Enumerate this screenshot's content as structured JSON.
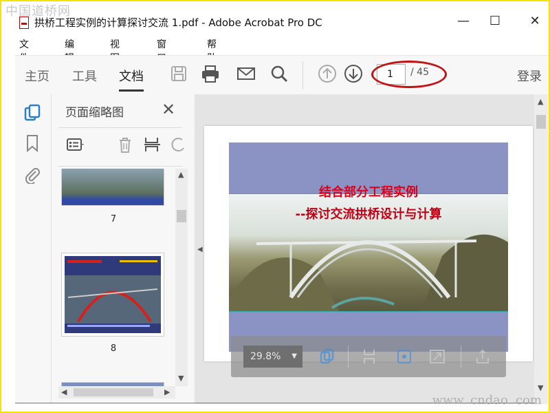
{
  "watermark_top": "中国道桥网",
  "watermark_bottom": "www. cndao. com",
  "window": {
    "title": "拱桥工程实例的计算探讨交流 1.pdf - Adobe Acrobat Pro DC",
    "minimize": "—",
    "maximize": "☐",
    "close": "✕"
  },
  "menu": [
    "文件(F)",
    "编辑(E)",
    "视图(V)",
    "窗口(W)",
    "帮助(H)"
  ],
  "toolbar": {
    "tabs": [
      "主页",
      "工具",
      "文档"
    ],
    "active_tab": "文档",
    "icons": [
      "save-icon",
      "print-icon",
      "email-icon",
      "search-icon",
      "page-up-icon",
      "page-down-icon"
    ],
    "page_current": "1",
    "page_total": "/ 45",
    "login": "登录"
  },
  "thumbnail_panel": {
    "title": "页面缩略图",
    "close": "✕",
    "pages": [
      {
        "label": "7"
      },
      {
        "label": "8"
      }
    ]
  },
  "slide": {
    "title": "结合部分工程实例",
    "subtitle": "--探讨交流拱桥设计与计算"
  },
  "float_toolbar": {
    "zoom": "29.8%"
  },
  "colors": {
    "accent": "#2d7fc1",
    "slide_bg": "#8a93c4",
    "slide_title": "#e0001a",
    "highlight_ellipse": "#c21212"
  }
}
